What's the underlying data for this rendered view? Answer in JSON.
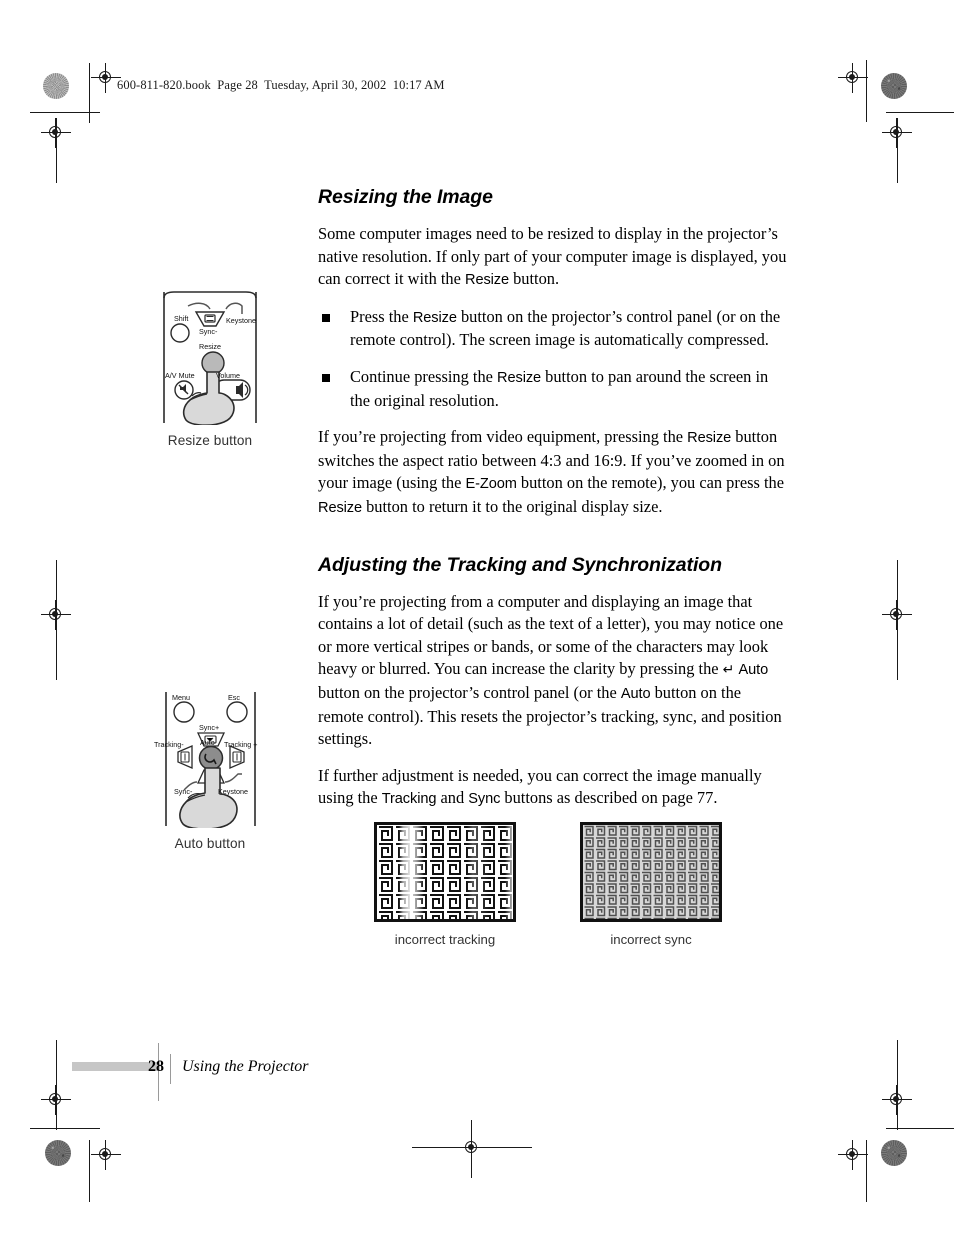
{
  "page_header": "600-811-820.book  Page 28  Tuesday, April 30, 2002  10:17 AM",
  "sections": [
    {
      "title": "Resizing the Image",
      "intro_1": "Some computer images need to be resized to display in the projector’s native resolution. If only part of your computer image is displayed, you can correct it with the ",
      "intro_1_ui": "Resize",
      "intro_1_end": " button.",
      "bullets": [
        {
          "pre": "Press the ",
          "ui": "Resize",
          "post": " button on the projector’s control panel (or on the remote control). The screen image is automatically compressed."
        },
        {
          "pre": "Continue pressing the ",
          "ui": "Resize",
          "post": " button to pan around the screen in the original resolution."
        }
      ],
      "outro_a": "If you’re projecting from video equipment, pressing the ",
      "outro_ui_1": "Resize",
      "outro_b": " button switches the aspect ratio between 4:3 and 16:9. If you’ve zoomed in on your image (using the ",
      "outro_ui_2": "E-Zoom",
      "outro_c": " button on the remote), you can press the ",
      "outro_ui_3": "Resize",
      "outro_d": " button to return it to the original display size."
    },
    {
      "title": "Adjusting the Tracking and Synchronization",
      "para_a": "If you’re projecting from a computer and displaying an image that contains a lot of detail (such as the text of a letter), you may notice one or more vertical stripes or bands, or some of the characters may look heavy or blurred. You can increase the clarity by pressing the ",
      "enter_glyph": "↵",
      "ui_auto_1": "Auto",
      "para_b": " button on the projector’s control panel (or the ",
      "ui_auto_2": "Auto",
      "para_c": " button on the remote control). This resets the projector’s tracking, sync, and position settings.",
      "para_d": "If further adjustment is needed, you can correct the image manually using the ",
      "ui_tracking": "Tracking",
      "para_e": " and ",
      "ui_sync": "Sync",
      "para_f": " buttons as described on page 77."
    }
  ],
  "figures": [
    {
      "caption": "Resize button",
      "labels": {
        "shift": "Shift",
        "keystone": "Keystone",
        "sync_minus": "Sync-",
        "resize": "Resize",
        "av_mute": "A/V Mute",
        "volume": "Volume"
      }
    },
    {
      "caption": "Auto button",
      "labels": {
        "menu": "Menu",
        "esc": "Esc",
        "sync_plus": "Sync+",
        "tracking_minus": "Tracking-",
        "auto": "Auto",
        "tracking_plus": "Tracking +",
        "sync_minus": "Sync-",
        "keystone": "Keystone"
      }
    }
  ],
  "samples": [
    {
      "caption": "incorrect tracking"
    },
    {
      "caption": "incorrect sync"
    }
  ],
  "footer": {
    "page_number": "28",
    "section_name": "Using the Projector"
  },
  "colors": {
    "ink": "#000000",
    "rule": "#9a9a9a",
    "footer_bar": "#c6c6c6",
    "illustration_fill": "#d9d9d9",
    "illustration_stroke": "#2b2b2b"
  }
}
